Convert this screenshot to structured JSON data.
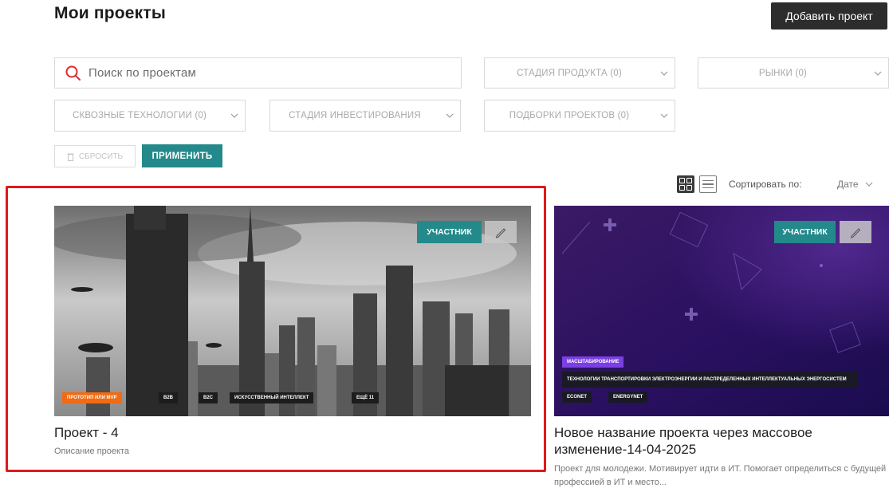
{
  "header": {
    "title": "Мои проекты",
    "add_button": "Добавить проект"
  },
  "filters": {
    "search_placeholder": "Поиск по проектам",
    "stage": "СТАДИЯ ПРОДУКТА (0)",
    "markets": "РЫНКИ (0)",
    "technologies": "СКВОЗНЫЕ ТЕХНОЛОГИИ (0)",
    "investment": "СТАДИЯ ИНВЕСТИРОВАНИЯ",
    "collections": "ПОДБОРКИ ПРОЕКТОВ (0)",
    "reset": "СБРОСИТЬ",
    "apply": "ПРИМЕНИТЬ"
  },
  "toolbar": {
    "sort_label": "Сортировать по:",
    "sort_value": "Дате"
  },
  "projects": [
    {
      "role": "УЧАСТНИК",
      "tags": [
        "ПРОТОТИП ИЛИ MVP",
        "B2B",
        "B2C",
        "ИСКУССТВЕННЫЙ ИНТЕЛЛЕКТ",
        "ЕЩЁ 11"
      ],
      "title": "Проект - 4",
      "description": "Описание проекта"
    },
    {
      "role": "УЧАСТНИК",
      "tags": [
        "МАСШТАБИРОВАНИЕ",
        "ТЕХНОЛОГИИ ТРАНСПОРТИРОВКИ ЭЛЕКТРОЭНЕРГИИ И РАСПРЕДЕЛЕННЫХ ИНТЕЛЛЕКТУАЛЬНЫХ ЭНЕРГОСИСТЕМ",
        "ECONET",
        "ENERGYNET"
      ],
      "title": "Новое название проекта через массовое изменение-14-04-2025",
      "description": "Проект для молодежи. Мотивирует идти в ИТ. Помогает определиться с будущей профессией в ИТ и место..."
    }
  ],
  "colors": {
    "accent": "#23898a",
    "highlight": "#e01919",
    "tag_orange": "#f26a12",
    "tag_purple": "#7b3fe4"
  },
  "icons": {
    "search": "search-icon",
    "chevron": "chevron-down-icon",
    "trash": "trash-icon",
    "edit": "pencil-icon",
    "grid": "grid-view-icon",
    "list": "list-view-icon"
  }
}
